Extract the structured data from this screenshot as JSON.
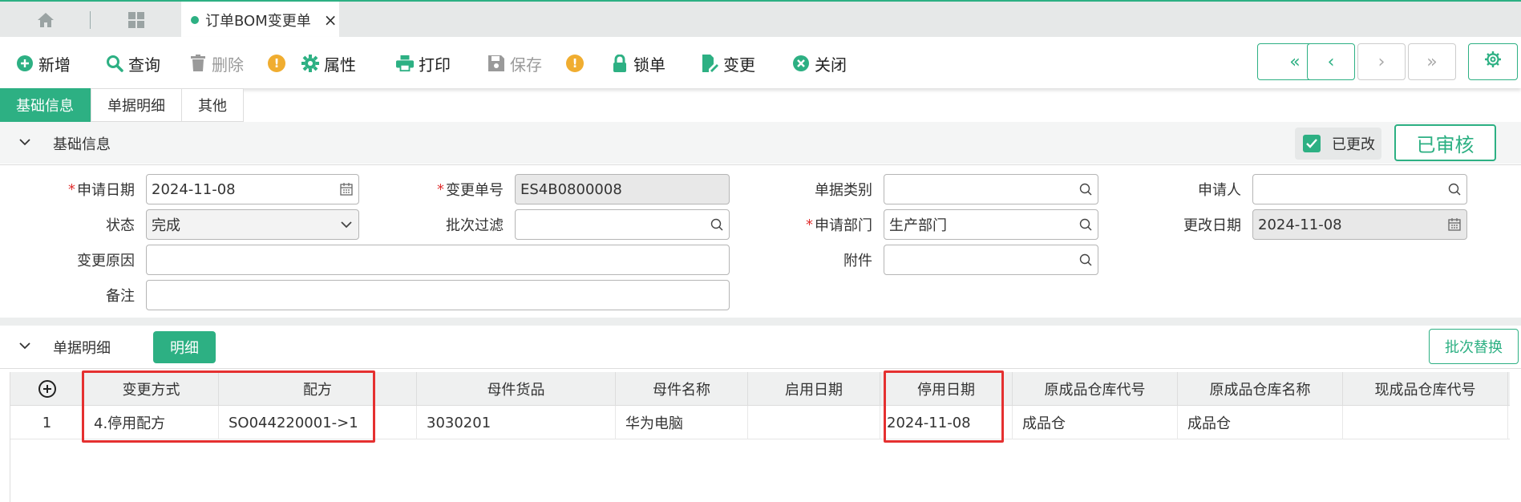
{
  "tabbar": {
    "home_icon": "home-icon",
    "grid_icon": "grid-icon",
    "active_tab": "订单BOM变更单",
    "close": "×"
  },
  "toolbar": {
    "add": "新增",
    "query": "查询",
    "delete": "删除",
    "properties": "属性",
    "print": "打印",
    "save": "保存",
    "lock": "锁单",
    "change": "变更",
    "close": "关闭",
    "warn": "!",
    "nav": [
      "«",
      "‹",
      "›",
      "»"
    ]
  },
  "sectabs": [
    "基础信息",
    "单据明细",
    "其他"
  ],
  "basic": {
    "title": "基础信息",
    "changed_label": "已更改",
    "approved_label": "已审核"
  },
  "form": {
    "apply_date_label": "申请日期",
    "apply_date": "2024-11-08",
    "change_no_label": "变更单号",
    "change_no": "ES4B0800008",
    "doc_type_label": "单据类别",
    "doc_type": "",
    "applicant_label": "申请人",
    "applicant": "",
    "status_label": "状态",
    "status": "完成",
    "batch_filter_label": "批次过滤",
    "batch_filter": "",
    "dept_label": "申请部门",
    "dept": "生产部门",
    "modify_date_label": "更改日期",
    "modify_date": "2024-11-08",
    "reason_label": "变更原因",
    "reason": "",
    "attachment_label": "附件",
    "attachment": "",
    "remark_label": "备注",
    "remark": ""
  },
  "detail": {
    "title": "单据明细",
    "detail_button": "明细",
    "batch_replace_button": "批次替换",
    "add_row_icon": "⊕",
    "columns": [
      "变更方式",
      "配方",
      "母件货品",
      "母件名称",
      "启用日期",
      "停用日期",
      "原成品仓库代号",
      "原成品仓库名称",
      "现成品仓库代号"
    ],
    "rows": [
      {
        "no": "1",
        "cells": [
          "4.停用配方",
          "SO044220001->1",
          "3030201",
          "华为电脑",
          "",
          "2024-11-08",
          "成品仓",
          "成品仓",
          ""
        ]
      }
    ]
  },
  "colors": {
    "accent": "#2db083",
    "highlight": "#e53030",
    "warning": "#f0ad30"
  }
}
